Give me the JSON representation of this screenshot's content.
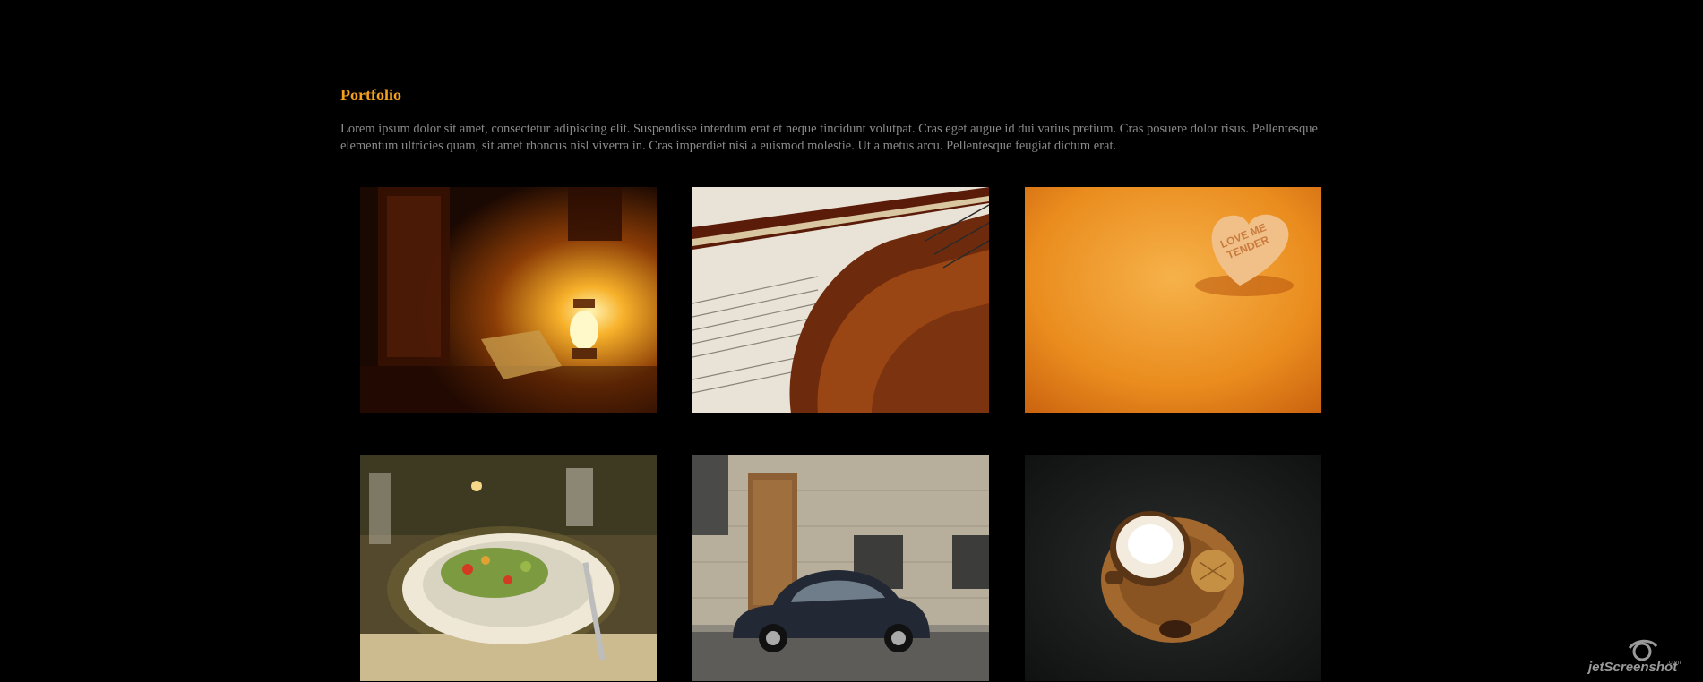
{
  "portfolio": {
    "title": "Portfolio",
    "intro": "Lorem ipsum dolor sit amet, consectetur adipiscing elit. Suspendisse interdum erat et neque tincidunt volutpat. Cras eget augue id dui varius pretium. Cras posuere dolor risus. Pellentesque elementum ultricies quam, sit amet rhoncus nisl viverra in. Cras imperdiet nisi a euismod molestie. Ut a metus arcu. Pellentesque feugiat dictum erat.",
    "images": [
      {
        "subject": "lantern-by-door"
      },
      {
        "subject": "violin-with-sheet-music"
      },
      {
        "subject": "candy-heart-love-me-tender"
      },
      {
        "subject": "dinner-plate-salad"
      },
      {
        "subject": "small-car-on-street"
      },
      {
        "subject": "coffee-and-cookies"
      }
    ],
    "candy_text": [
      "LOVE ME",
      "TENDER"
    ]
  },
  "watermark": {
    "brand": "jetScreenshot",
    "suffix": ".com"
  },
  "colors": {
    "background": "#000000",
    "title": "#f4a11e",
    "text": "#8a8a8a"
  }
}
